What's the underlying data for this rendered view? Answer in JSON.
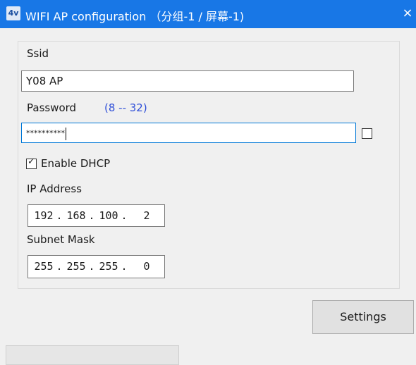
{
  "window": {
    "title": "WIFI AP configuration （分组-1 / 屏幕-1)",
    "icon_text": "4v",
    "close_label": "×"
  },
  "form": {
    "ssid_label": "Ssid",
    "ssid_value": "Y08 AP",
    "password_label": "Password",
    "password_hint": "(8 -- 32)",
    "password_value": "**********",
    "show_password_checked": false,
    "dhcp_label": "Enable DHCP",
    "dhcp_checked": true,
    "dhcp_checkmark": "✓",
    "ip_label": "IP Address",
    "ip_octets": [
      "192",
      "168",
      "100",
      "2"
    ],
    "ip_separator": ".",
    "subnet_label": "Subnet Mask",
    "subnet_octets": [
      "255",
      "255",
      "255",
      "0"
    ]
  },
  "buttons": {
    "settings_label": "Settings"
  },
  "colors": {
    "titlebar": "#1877e6",
    "hint": "#2f4fd8",
    "focus_border": "#0078d7"
  }
}
